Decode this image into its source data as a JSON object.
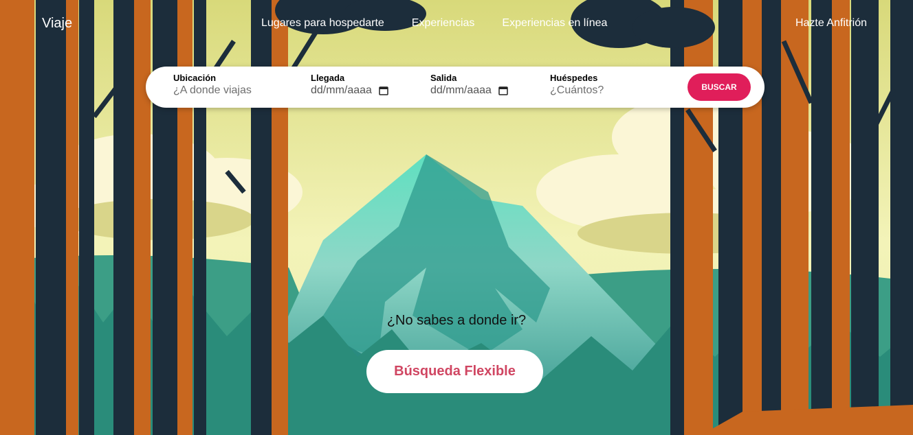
{
  "nav": {
    "brand": "Viaje",
    "links": [
      "Lugares para hospedarte",
      "Experiencias",
      "Experiencias en línea"
    ],
    "host": "Hazte Anfitrión"
  },
  "search": {
    "location": {
      "label": "Ubicación",
      "placeholder": "¿A donde viajas"
    },
    "checkin": {
      "label": "Llegada",
      "value": "dd/mm/aaaa",
      "icon": "calendar-icon"
    },
    "checkout": {
      "label": "Salida",
      "value": "dd/mm/aaaa",
      "icon": "calendar-icon"
    },
    "guests": {
      "label": "Huéspedes",
      "placeholder": "¿Cuántos?"
    },
    "button": "BUSCAR"
  },
  "hero": {
    "question": "¿No sabes a donde ir?",
    "flex_button": "Búsqueda Flexible"
  },
  "colors": {
    "accent": "#e01e5a",
    "flex_text": "#d04662",
    "sky": "#e6e79b",
    "mountain": "#2a9a8c",
    "tree_dark": "#1c2d3b",
    "tree_orange": "#c8671f"
  }
}
